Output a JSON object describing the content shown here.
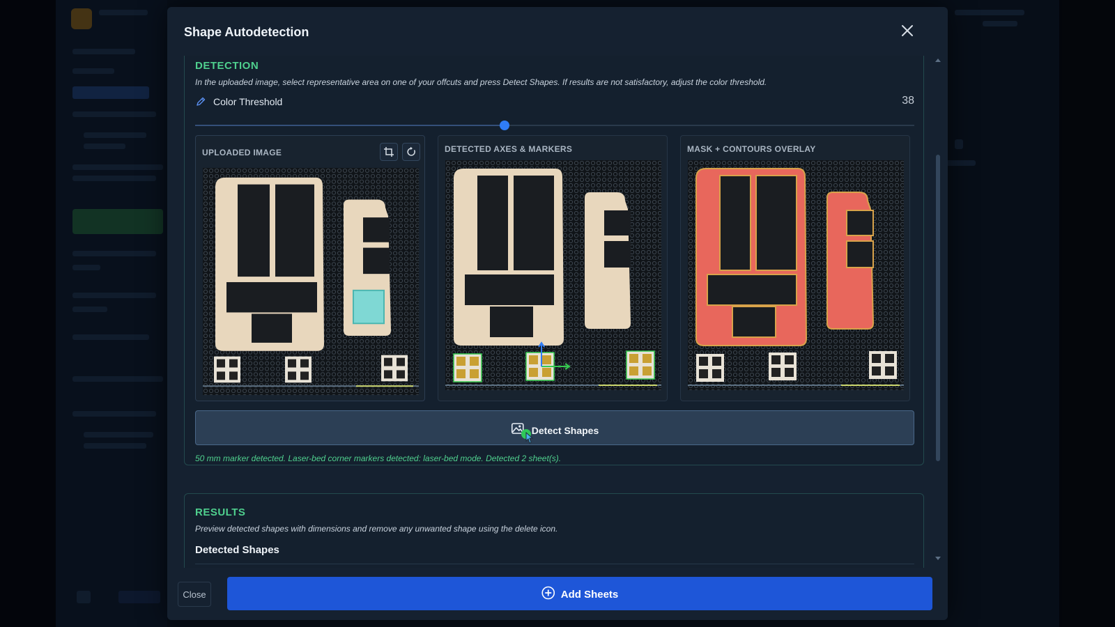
{
  "modal": {
    "title": "Shape Autodetection",
    "close_icon": "close-icon"
  },
  "detection": {
    "title": "DETECTION",
    "description": "In the uploaded image, select representative area on one of your offcuts and press Detect Shapes. If results are not satisfactory, adjust the color threshold.",
    "threshold_label": "Color Threshold",
    "threshold_value": "38",
    "threshold_fraction": 0.43,
    "threshold_icon": "pen-icon",
    "panels": [
      {
        "title": "UPLOADED IMAGE",
        "image": "uploaded-offcut-photo"
      },
      {
        "title": "DETECTED AXES & MARKERS",
        "image": "detected-axes-markers-photo"
      },
      {
        "title": "MASK + CONTOURS OVERLAY",
        "image": "mask-contours-overlay-photo"
      }
    ],
    "tools": {
      "crop_icon": "crop-icon",
      "rotate_icon": "rotate-icon"
    },
    "detect_button": "Detect Shapes",
    "detect_icon": "image-scan-icon",
    "status": "50 mm marker detected. Laser-bed corner markers detected: laser-bed mode. Detected 2 sheet(s)."
  },
  "results": {
    "title": "RESULTS",
    "description": "Preview detected shapes with dimensions and remove any unwanted shape using the delete icon.",
    "subtitle": "Detected Shapes"
  },
  "footer": {
    "close_label": "Close",
    "add_label": "Add Sheets",
    "add_icon": "plus-circle-icon"
  },
  "colors": {
    "accent_green": "#4fd08e",
    "primary_blue": "#1e56d8",
    "slider_blue": "#2f7cf6",
    "mask_red": "#e8675c",
    "selection_cyan": "#7fd8d4"
  }
}
